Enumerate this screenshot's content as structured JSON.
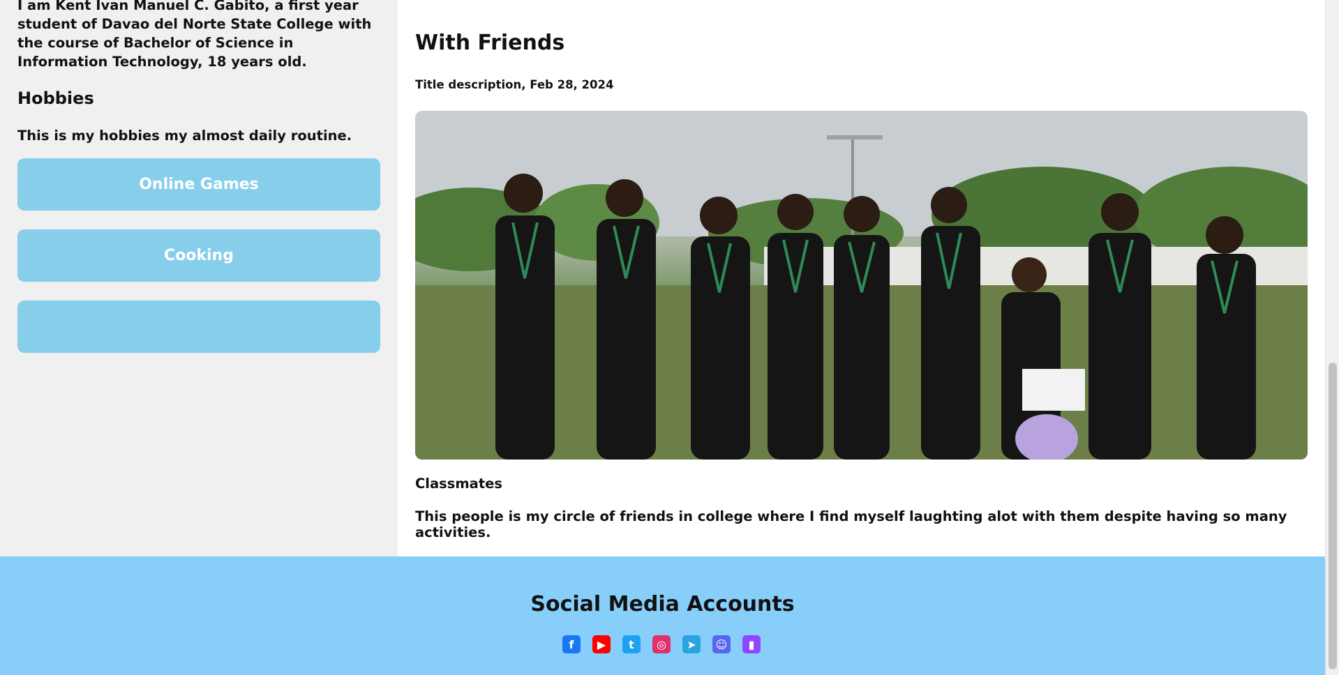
{
  "sidebar": {
    "about_text": "I am Kent Ivan Manuel C. Gabito, a first year student of Davao del Norte State College with the course of Bachelor of Science in Information Technology, 18 years old.",
    "hobbies_heading": "Hobbies",
    "hobbies_desc": "This is my hobbies my almost daily routine.",
    "hobbies": [
      {
        "label": "Online Games"
      },
      {
        "label": "Cooking"
      },
      {
        "label": ""
      }
    ]
  },
  "post": {
    "title": "With Friends",
    "meta": "Title description, Feb 28, 2024",
    "caption_title": "Classmates",
    "caption_text": "This people is my circle of friends in college where I find myself laughting alot with them despite having so many activities."
  },
  "footer": {
    "title": "Social Media Accounts",
    "icons": [
      {
        "name": "facebook-icon",
        "color": "#1877f2",
        "glyph": "f"
      },
      {
        "name": "youtube-icon",
        "color": "#ff0000",
        "glyph": "▶"
      },
      {
        "name": "twitter-icon",
        "color": "#1da1f2",
        "glyph": "t"
      },
      {
        "name": "instagram-icon",
        "color": "#e1306c",
        "glyph": "◎"
      },
      {
        "name": "telegram-icon",
        "color": "#2aa3e0",
        "glyph": "➤"
      },
      {
        "name": "discord-icon",
        "color": "#5865f2",
        "glyph": "☺"
      },
      {
        "name": "twitch-icon",
        "color": "#9146ff",
        "glyph": "▮"
      }
    ]
  },
  "colors": {
    "accent": "#87ceeb",
    "footer_bg": "#87cefa",
    "sidebar_bg": "#f0f0f0"
  }
}
